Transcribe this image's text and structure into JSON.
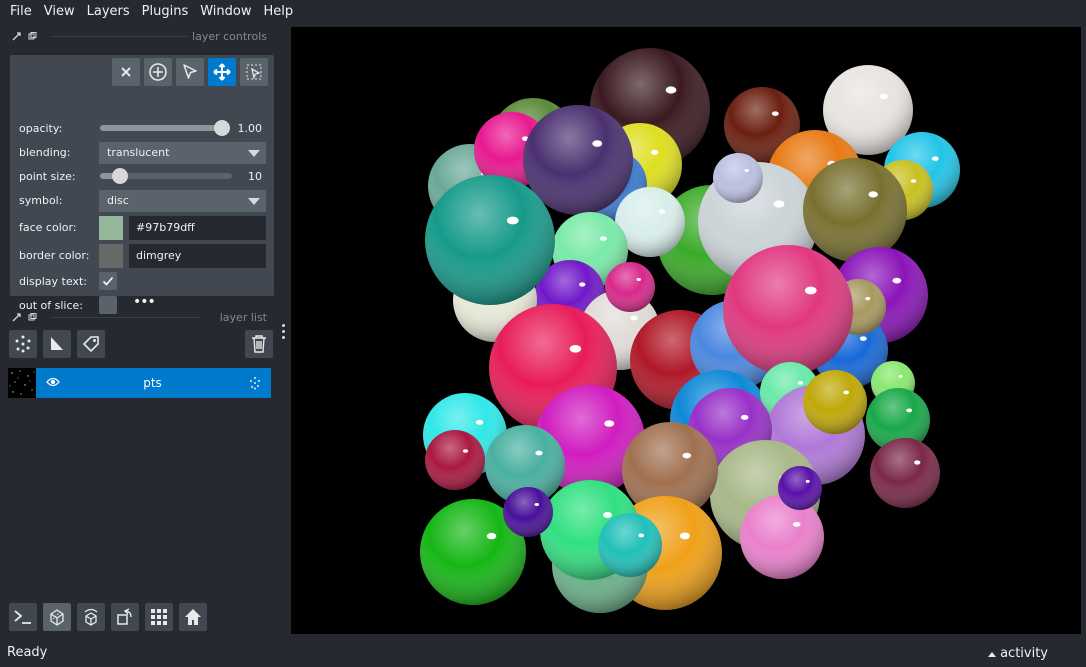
{
  "menubar": {
    "items": [
      "File",
      "View",
      "Layers",
      "Plugins",
      "Window",
      "Help"
    ]
  },
  "layer_controls": {
    "title": "layer controls",
    "opacity": {
      "label": "opacity:",
      "value": "1.00",
      "fraction": 1.0
    },
    "blending": {
      "label": "blending:",
      "value": "translucent"
    },
    "point_size": {
      "label": "point size:",
      "value": "10",
      "fraction": 0.1
    },
    "symbol": {
      "label": "symbol:",
      "value": "disc"
    },
    "face_color": {
      "label": "face color:",
      "value": "#97b79dff",
      "swatch": "#97b79d"
    },
    "border_color": {
      "label": "border color:",
      "value": "dimgrey",
      "swatch": "#696969"
    },
    "display_text": {
      "label": "display text:",
      "checked": true
    },
    "out_of_slice": {
      "label": "out of slice:",
      "checked": false
    }
  },
  "layer_list": {
    "title": "layer list",
    "layers": [
      {
        "name": "pts",
        "visible": true
      }
    ]
  },
  "status": {
    "text": "Ready",
    "activity": "activity"
  },
  "colors": {
    "accent": "#007acc",
    "background": "#262930",
    "panel": "#414851"
  }
}
